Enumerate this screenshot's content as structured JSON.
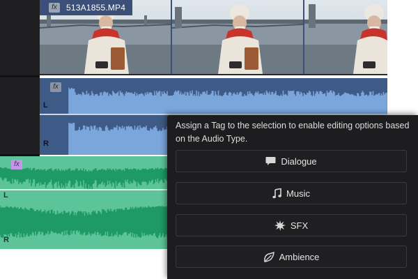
{
  "video_clip": {
    "filename": "513A1855.MP4",
    "fx_icon": "fx-badge-icon"
  },
  "audio_clip_blue": {
    "fx_icon": "fx-badge-icon",
    "channel_left": "L",
    "channel_right": "R"
  },
  "audio_clip_green": {
    "fx_icon": "fx-badge-icon",
    "channel_left": "L",
    "channel_right": "R"
  },
  "tag_panel": {
    "description": "Assign a Tag to the selection to enable editing options based on the Audio Type.",
    "buttons": [
      {
        "label": "Dialogue",
        "icon": "speech-bubble-icon"
      },
      {
        "label": "Music",
        "icon": "music-note-icon"
      },
      {
        "label": "SFX",
        "icon": "burst-icon"
      },
      {
        "label": "Ambience",
        "icon": "leaf-icon"
      }
    ]
  },
  "colors": {
    "blue_clip": "#3e5a86",
    "blue_waveform": "#7aa6dc",
    "green_clip": "#5cc498",
    "green_waveform": "#1e9a66",
    "panel_bg": "#1d1d1f",
    "label_bar": "#3b4f78"
  }
}
